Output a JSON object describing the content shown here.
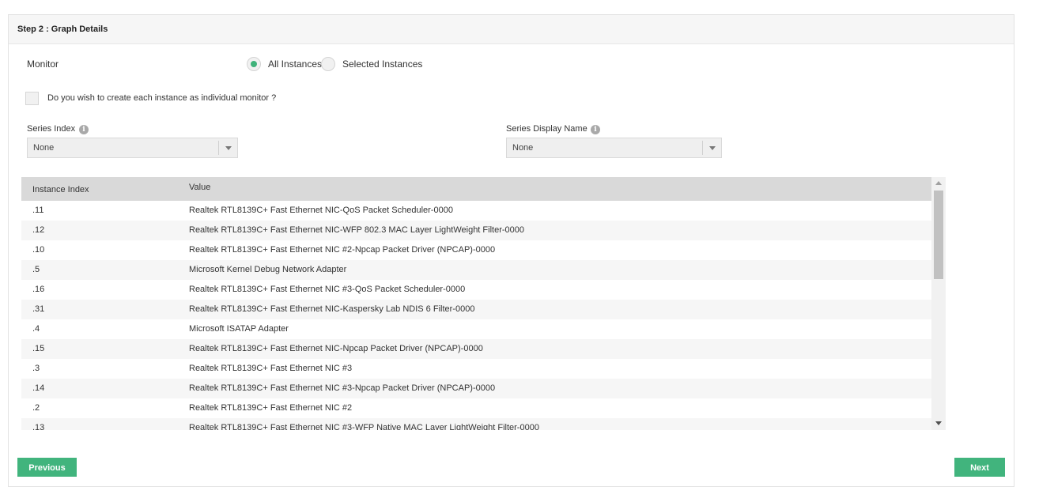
{
  "step_title": "Step 2 : Graph Details",
  "monitor": {
    "label": "Monitor",
    "options": [
      {
        "label": "All Instances",
        "checked": true
      },
      {
        "label": "Selected Instances",
        "checked": false
      }
    ]
  },
  "individual_monitor": {
    "label": "Do you wish to create each instance as individual monitor ?",
    "checked": false
  },
  "series_index": {
    "label": "Series Index",
    "value": "None",
    "icon": "info-icon"
  },
  "series_display_name": {
    "label": "Series Display Name",
    "value": "None",
    "icon": "info-icon"
  },
  "table": {
    "headers": [
      "Instance Index",
      "Value"
    ],
    "rows": [
      {
        "index": ".11",
        "value": "Realtek RTL8139C+ Fast Ethernet NIC-QoS Packet Scheduler-0000"
      },
      {
        "index": ".12",
        "value": "Realtek RTL8139C+ Fast Ethernet NIC-WFP 802.3 MAC Layer LightWeight Filter-0000"
      },
      {
        "index": ".10",
        "value": "Realtek RTL8139C+ Fast Ethernet NIC #2-Npcap Packet Driver (NPCAP)-0000"
      },
      {
        "index": ".5",
        "value": "Microsoft Kernel Debug Network Adapter"
      },
      {
        "index": ".16",
        "value": "Realtek RTL8139C+ Fast Ethernet NIC #3-QoS Packet Scheduler-0000"
      },
      {
        "index": ".31",
        "value": "Realtek RTL8139C+ Fast Ethernet NIC-Kaspersky Lab NDIS 6 Filter-0000"
      },
      {
        "index": ".4",
        "value": "Microsoft ISATAP Adapter"
      },
      {
        "index": ".15",
        "value": "Realtek RTL8139C+ Fast Ethernet NIC-Npcap Packet Driver (NPCAP)-0000"
      },
      {
        "index": ".3",
        "value": "Realtek RTL8139C+ Fast Ethernet NIC #3"
      },
      {
        "index": ".14",
        "value": "Realtek RTL8139C+ Fast Ethernet NIC #3-Npcap Packet Driver (NPCAP)-0000"
      },
      {
        "index": ".2",
        "value": "Realtek RTL8139C+ Fast Ethernet NIC #2"
      },
      {
        "index": ".13",
        "value": "Realtek RTL8139C+ Fast Ethernet NIC #3-WFP Native MAC Layer LightWeight Filter-0000"
      }
    ]
  },
  "buttons": {
    "previous": "Previous",
    "next": "Next"
  },
  "colors": {
    "accent": "#41b47d",
    "header_bg": "#d9d9d9"
  }
}
